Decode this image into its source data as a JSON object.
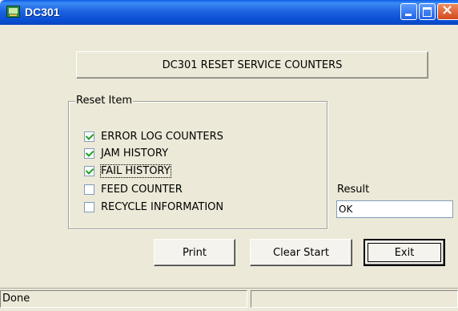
{
  "window": {
    "title": "DC301"
  },
  "header": {
    "title": "DC301 RESET SERVICE COUNTERS"
  },
  "reset_group": {
    "legend": "Reset Item",
    "items": [
      {
        "label": "ERROR LOG COUNTERS",
        "checked": true
      },
      {
        "label": "JAM HISTORY",
        "checked": true
      },
      {
        "label": "FAIL HISTORY",
        "checked": true,
        "focused": true
      },
      {
        "label": "FEED COUNTER",
        "checked": false
      },
      {
        "label": "RECYCLE INFORMATION",
        "checked": false
      }
    ]
  },
  "result": {
    "label": "Result",
    "value": "OK"
  },
  "buttons": {
    "print": "Print",
    "clear_start": "Clear Start",
    "exit": "Exit"
  },
  "statusbar": {
    "text": "Done"
  },
  "colors": {
    "titlebar": "#0a5ce6",
    "background": "#ece9d8",
    "check": "#21a121"
  }
}
